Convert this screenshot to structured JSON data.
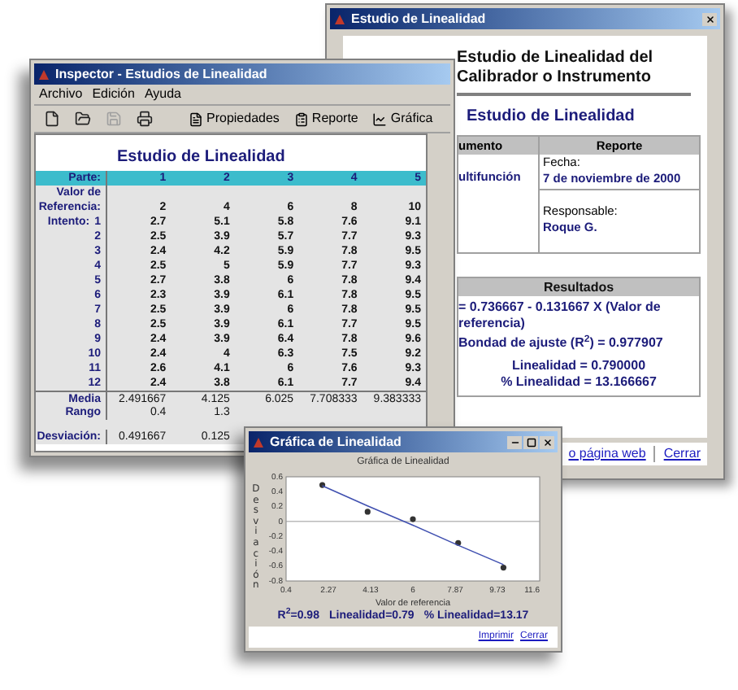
{
  "report_window": {
    "title": "Estudio de Linealidad",
    "heading": "Estudio de Linealidad del Calibrador o Instrumento",
    "subheading": "Estudio de Linealidad",
    "info_table": {
      "columns": [
        "umento",
        "Reporte"
      ],
      "device": "ultifunción",
      "date_label": "Fecha:",
      "date": "7 de noviembre de 2000",
      "owner_label": "Responsable:",
      "owner": "Roque G."
    },
    "results": {
      "title": "Resultados",
      "formula": [
        "= 0.736667 - 0.131667 X (Valor de referencia)",
        "Bondad de ajuste (R$^{2}$) = 0.977907"
      ],
      "summary": [
        "Linealidad = 0.790000",
        "% Linealidad = 13.166667"
      ]
    },
    "links": [
      "o página web",
      "Cerrar"
    ]
  },
  "inspector_window": {
    "title": "Inspector - Estudios de Linealidad",
    "menu": [
      "Archivo",
      "Edición",
      "Ayuda"
    ],
    "toolbar": {
      "icon_buttons": [
        {
          "disabled": false
        },
        {
          "disabled": false
        },
        {
          "disabled": true
        },
        {
          "disabled": false
        }
      ],
      "buttons": [
        "Propiedades",
        "Reporte",
        "Gráfica"
      ]
    },
    "heading": "Estudio de Linealidad",
    "table": {
      "part_label": "Parte:",
      "parts": [
        "1",
        "2",
        "3",
        "4",
        "5"
      ],
      "reference_label": "Valor de Referencia:",
      "reference": [
        "2",
        "4",
        "6",
        "8",
        "10"
      ],
      "trial_label": "Intento:",
      "trials": [
        {
          "number": "1",
          "values": [
            "2.7",
            "5.1",
            "5.8",
            "7.6",
            "9.1"
          ]
        },
        {
          "number": "2",
          "values": [
            "2.5",
            "3.9",
            "5.7",
            "7.7",
            "9.3"
          ]
        },
        {
          "number": "3",
          "values": [
            "2.4",
            "4.2",
            "5.9",
            "7.8",
            "9.5"
          ]
        },
        {
          "number": "4",
          "values": [
            "2.5",
            "5",
            "5.9",
            "7.7",
            "9.3"
          ]
        },
        {
          "number": "5",
          "values": [
            "2.7",
            "3.8",
            "6",
            "7.8",
            "9.4"
          ]
        },
        {
          "number": "6",
          "values": [
            "2.3",
            "3.9",
            "6.1",
            "7.8",
            "9.5"
          ]
        },
        {
          "number": "7",
          "values": [
            "2.5",
            "3.9",
            "6",
            "7.8",
            "9.5"
          ]
        },
        {
          "number": "8",
          "values": [
            "2.5",
            "3.9",
            "6.1",
            "7.7",
            "9.5"
          ]
        },
        {
          "number": "9",
          "values": [
            "2.4",
            "3.9",
            "6.4",
            "7.8",
            "9.6"
          ]
        },
        {
          "number": "10",
          "values": [
            "2.4",
            "4",
            "6.3",
            "7.5",
            "9.2"
          ]
        },
        {
          "number": "11",
          "values": [
            "2.6",
            "4.1",
            "6",
            "7.6",
            "9.3"
          ]
        },
        {
          "number": "12",
          "values": [
            "2.4",
            "3.8",
            "6.1",
            "7.7",
            "9.4"
          ]
        }
      ],
      "summary_rows": [
        {
          "label": "Media",
          "values": [
            "2.491667",
            "4.125",
            "6.025",
            "7.708333",
            "9.383333"
          ]
        },
        {
          "label": "Rango",
          "values": [
            "0.4",
            "1.3"
          ]
        },
        {
          "label": "Desviación:",
          "values": [
            "0.491667",
            "0.125"
          ]
        }
      ]
    }
  },
  "chart_window": {
    "title": "Gráfica de Linealidad",
    "chart_data": {
      "type": "scatter",
      "title": "Gráfica de Linealidad",
      "xlabel": "Valor de referencia",
      "ylabel": "Desviación",
      "x": [
        2,
        4,
        6,
        8,
        10
      ],
      "series": [
        {
          "color": "#333333",
          "values": [
            0.49,
            0.13,
            0.03,
            -0.29,
            -0.62
          ]
        },
        {
          "type": "line",
          "color": "#4050b0",
          "values": [
            0.48,
            0.21,
            -0.05,
            -0.32,
            -0.58
          ]
        }
      ],
      "xlim": [
        0.4,
        11.6
      ],
      "ylim": [
        -0.8,
        0.6
      ],
      "xticks": [
        {
          "value": 0.4,
          "label": "0.4"
        },
        {
          "value": 2.27,
          "label": "2.27"
        },
        {
          "value": 4.13,
          "label": "4.13"
        },
        {
          "value": 6,
          "label": "6"
        },
        {
          "value": 7.87,
          "label": "7.87"
        },
        {
          "value": 9.73,
          "label": "9.73"
        },
        {
          "value": 11.6,
          "label": "11.6"
        }
      ],
      "yticks": [
        {
          "value": 0.6,
          "label": "0.6"
        },
        {
          "value": 0.4,
          "label": "0.4"
        },
        {
          "value": 0.2,
          "label": "0.2"
        },
        {
          "value": 0,
          "label": "0"
        },
        {
          "value": -0.2,
          "label": "-0.2"
        },
        {
          "value": -0.4,
          "label": "-0.4"
        },
        {
          "value": -0.6,
          "label": "-0.6"
        },
        {
          "value": -0.8,
          "label": "-0.8"
        }
      ]
    },
    "stats": [
      "R$^{2}$=0.98",
      "Linealidad=0.79",
      "% Linealidad=13.17"
    ],
    "links": [
      "Imprimir",
      "Cerrar"
    ]
  }
}
